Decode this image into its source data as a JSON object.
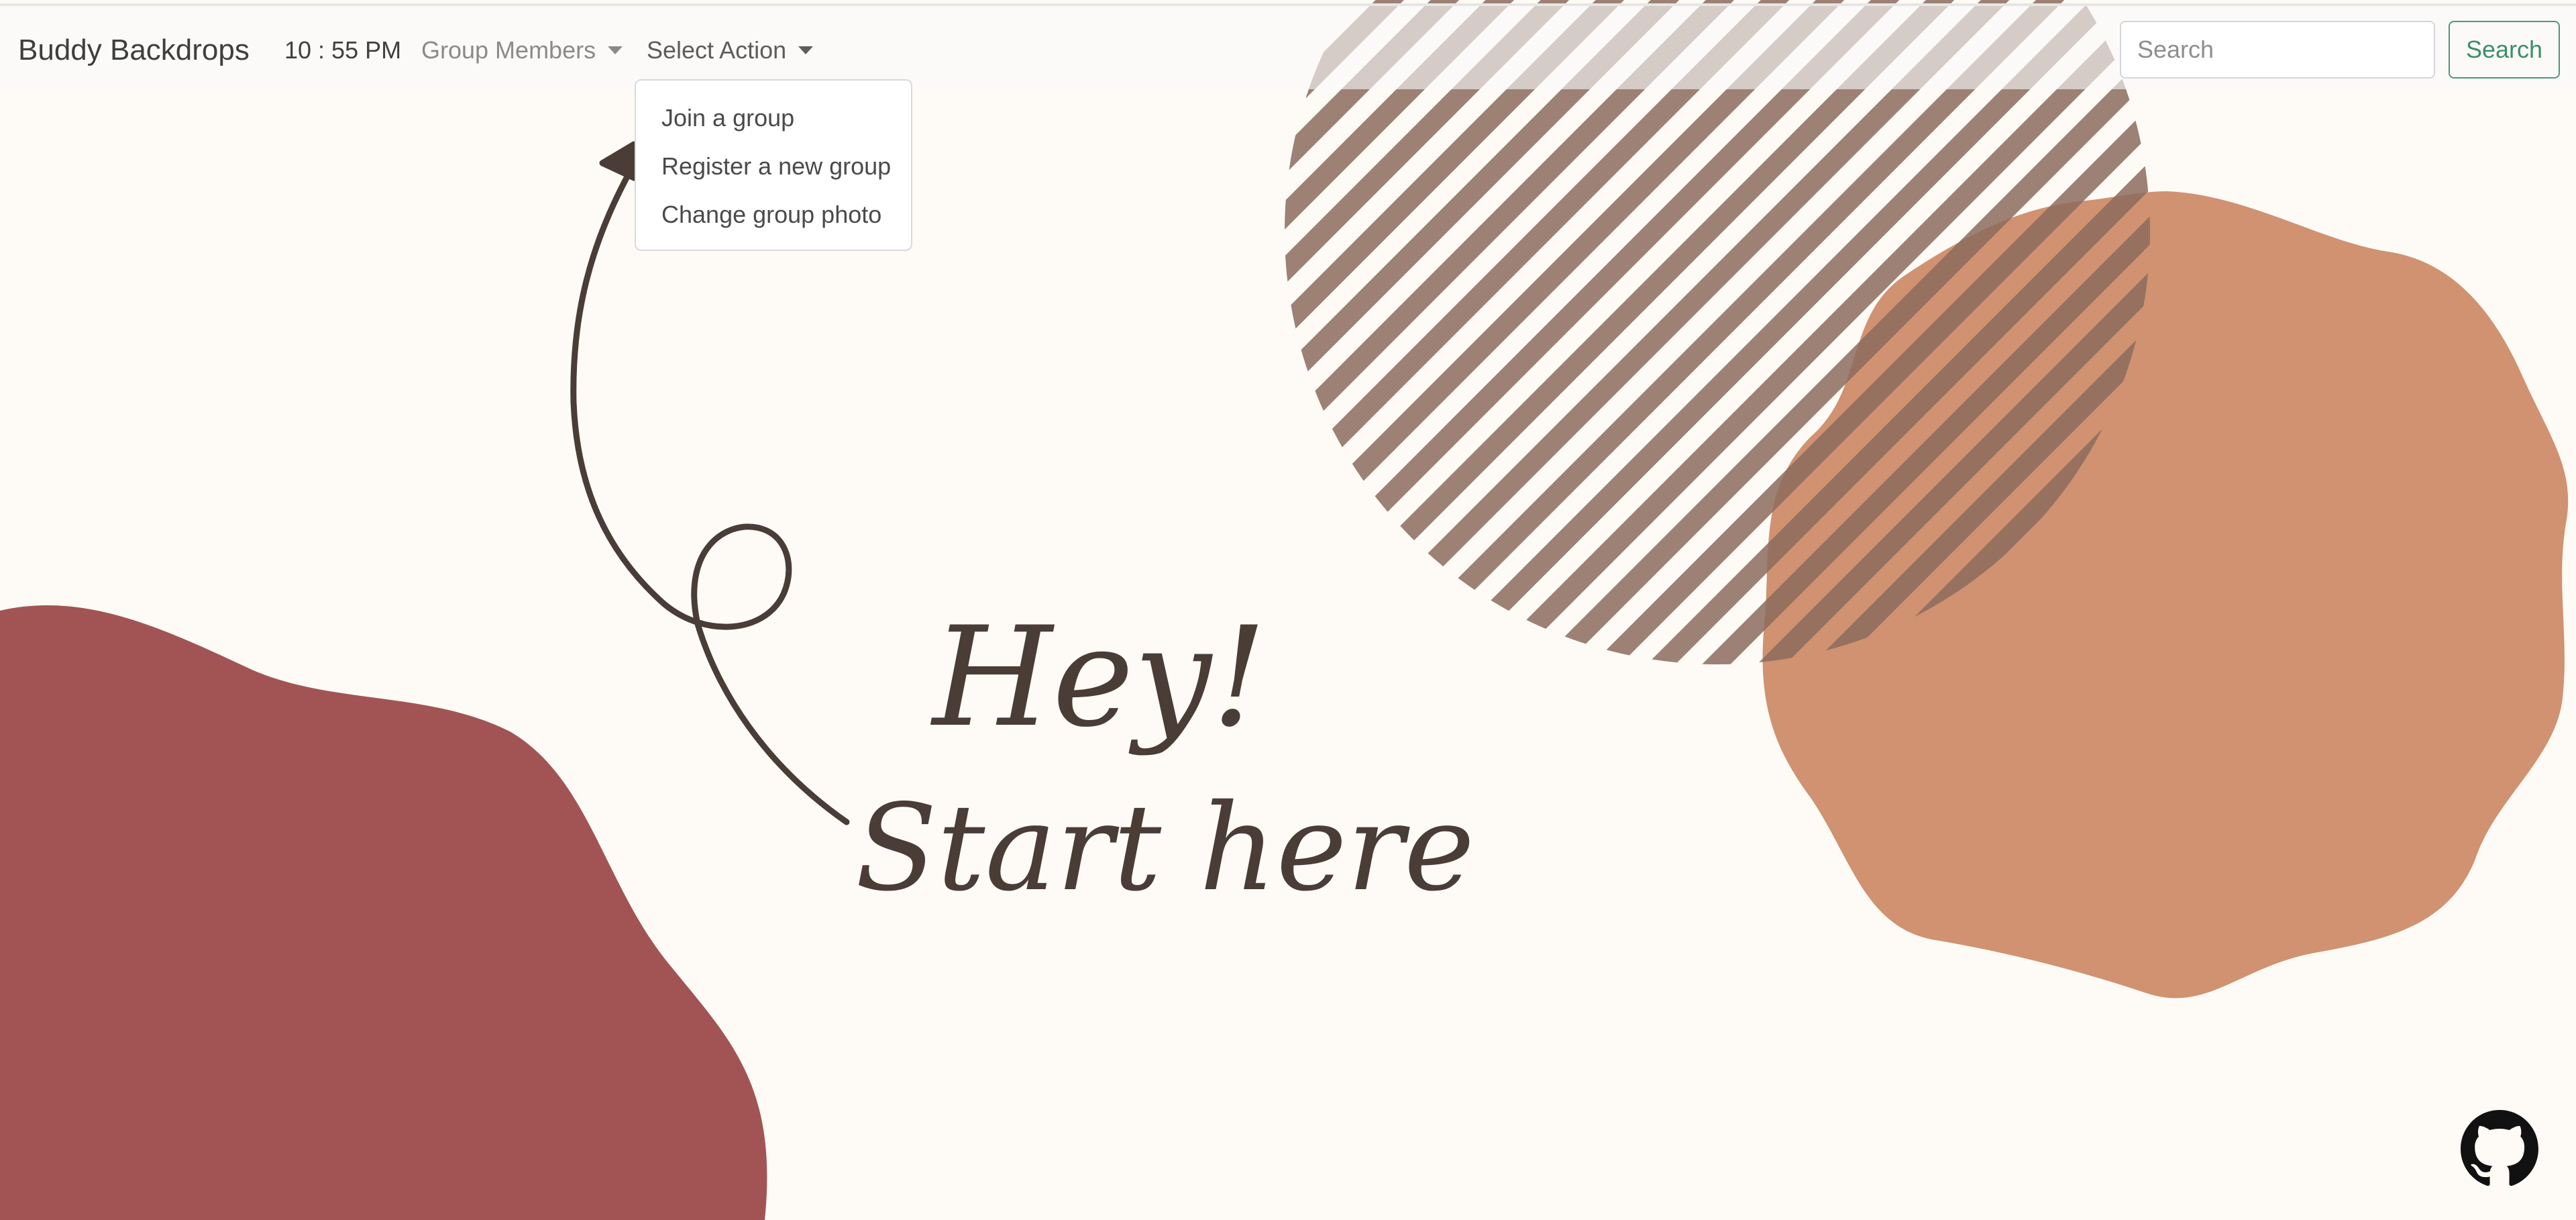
{
  "navbar": {
    "brand": "Buddy Backdrops",
    "clock": "10 : 55 PM",
    "group_members_label": "Group Members",
    "select_action_label": "Select Action"
  },
  "search": {
    "placeholder": "Search",
    "value": "",
    "button_label": "Search"
  },
  "action_menu": {
    "expanded": true,
    "items": [
      {
        "label": "Join a group"
      },
      {
        "label": "Register a new group"
      },
      {
        "label": "Change group photo"
      }
    ]
  },
  "hero": {
    "greeting": "Hey!",
    "call_to_action": "Start here"
  },
  "footer": {
    "github_icon": "github-icon"
  },
  "colors": {
    "page_background": "#fefbf6",
    "navbar_background": "#f8f9fa",
    "blob_red": "#a25454",
    "blob_orange": "#d09271",
    "stripe_brown": "#8c6c5e",
    "ink": "#4a3c36",
    "search_button": "#3e8d6b"
  }
}
